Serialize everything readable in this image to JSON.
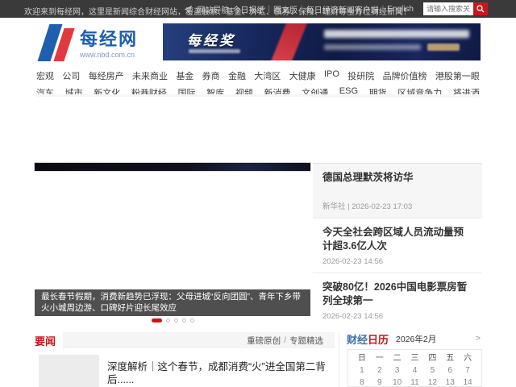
{
  "topbar": {
    "welcome": "欢迎来到每经网，这里是新闻综合财经网站，覆盖股票、基金、外汇、债券、保险、理财等全方位财经新闻！",
    "links": [
      "网站导航",
      "今日报纸",
      "图文版",
      "每日经济新闻客户端",
      "English"
    ],
    "separator": "|",
    "search_placeholder": "请输入搜索关键词"
  },
  "header": {
    "site_name": "每经网",
    "site_url": "www.nbd.com.cn",
    "banner_title": "每经奖"
  },
  "nav": {
    "row1": [
      "宏观",
      "公司",
      "每经房产",
      "未来商业",
      "基金",
      "券商",
      "金融",
      "大湾区",
      "大健康",
      "IPO",
      "投研院",
      "品牌价值榜",
      "港股第一眼"
    ],
    "row2": [
      "汽车",
      "城市",
      "新文化",
      "粉巷财经",
      "国际",
      "智库",
      "视频",
      "新消费",
      "文创通",
      "ESG",
      "期货",
      "区域竞争力",
      "将进酒"
    ]
  },
  "carousel": {
    "caption": "最长春节假期，消费新趋势已浮现：父母进城“反向团圆”、青年下乡带火小城周边游、口碑好片迎长尾效应",
    "dots_total": 5,
    "active_dot_index": 0
  },
  "sidebar": {
    "items": [
      {
        "title": "德国总理默茨将访华",
        "meta": "新华社 | 2026-02-23 17:03"
      },
      {
        "title": "今天全社会跨区域人员流动量预计超3.6亿人次",
        "meta": "2026-02-23 14:56"
      },
      {
        "title": "突破80亿！2026中国电影票房暂列全球第一",
        "meta": "2026-02-23 14:56"
      }
    ]
  },
  "news_section": {
    "tab_active": "要闻",
    "tab_links": [
      "重磅原创",
      "专题精选"
    ],
    "tab_separator": "/",
    "headline": "深度解析｜这个春节，成都消费“火”进全国第二背后......"
  },
  "calendar": {
    "title_blue": "财经",
    "title_red": "日历",
    "month": "2026年2月",
    "more_arrow": ">",
    "weekdays": [
      "日",
      "一",
      "二",
      "三",
      "四",
      "五",
      "六"
    ],
    "week1": [
      "1",
      "2",
      "3",
      "4",
      "5",
      "6",
      "7"
    ],
    "week2": [
      "8",
      "9",
      "10",
      "11",
      "12",
      "13",
      "14"
    ]
  },
  "colors": {
    "accent_red": "#c8161d",
    "brand_blue": "#1e5fae",
    "topbar_bg": "#3a3a3a",
    "banner_navy": "#16275c"
  }
}
